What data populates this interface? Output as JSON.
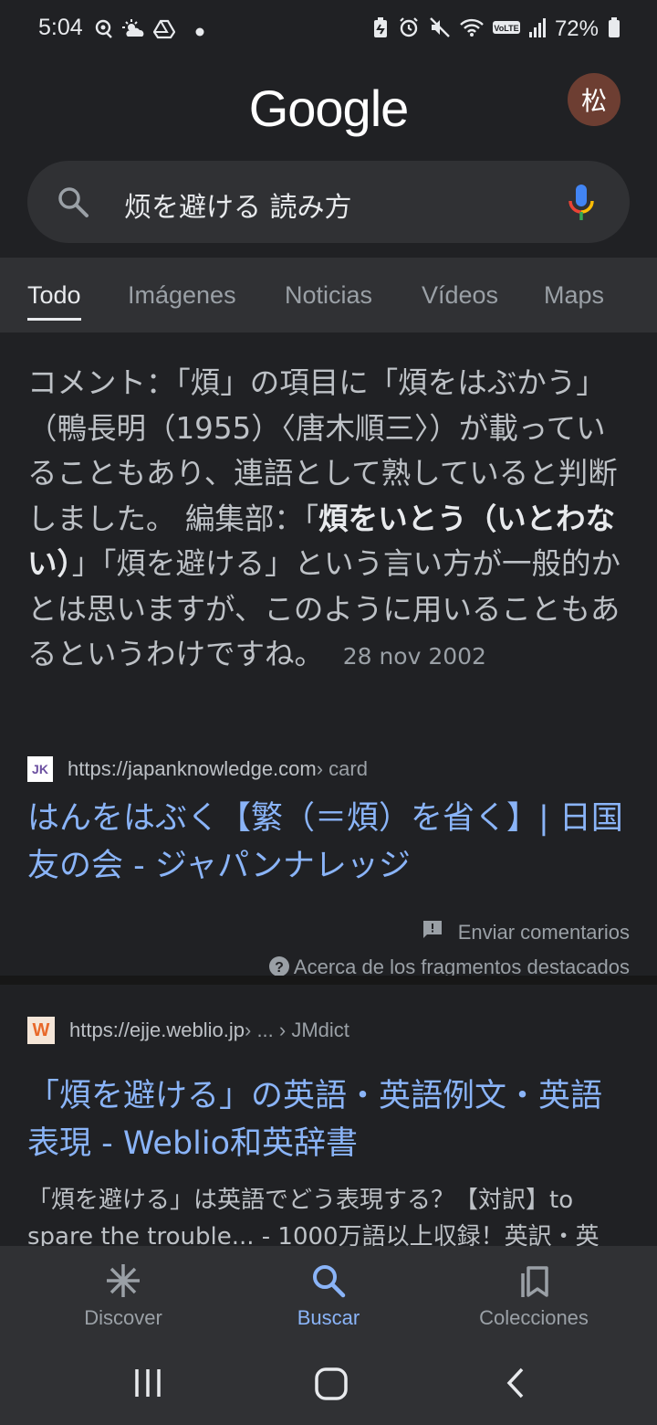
{
  "status_bar": {
    "time": "5:04",
    "battery": "72%",
    "left_icons": [
      "vpn-key-icon",
      "weather-icon",
      "drive-icon",
      "dot-icon"
    ],
    "right_icons": [
      "battery-saver-icon",
      "alarm-icon",
      "mute-icon",
      "wifi-icon",
      "volte-icon",
      "signal-icon",
      "battery-icon"
    ]
  },
  "header": {
    "logo": "Google",
    "avatar_letter": "松",
    "avatar_color": "#6d3e32"
  },
  "search": {
    "query": "烦を避ける 読み方"
  },
  "tabs": [
    {
      "label": "Todo",
      "active": true
    },
    {
      "label": "Imágenes",
      "active": false
    },
    {
      "label": "Noticias",
      "active": false
    },
    {
      "label": "Vídeos",
      "active": false
    },
    {
      "label": "Maps",
      "active": false
    }
  ],
  "featured_snippet": {
    "text_before": "コメント：「煩」の項目に「煩をはぶかう」（鴨長明（1955）〈唐木順三〉）が載っていることもあり、連語として熟していると判断しました。 編集部：「",
    "bold": "煩をいとう（いとわない）",
    "text_after": "」「煩を避ける」という言い方が一般的かとは思いますが、このように用いることもあるというわけですね。",
    "date": "28 nov 2002",
    "source": {
      "favicon": "JK",
      "url": "https://japanknowledge.com",
      "crumb": " › card"
    },
    "title": "はんをはぶく【繁（＝煩）を省く】| 日国友の会 - ジャパンナレッジ",
    "feedback": "Enviar comentarios",
    "about": "Acerca de los fragmentos destacados"
  },
  "result2": {
    "favicon": "W",
    "url": "https://ejje.weblio.jp",
    "crumb": " › ... › JMdict",
    "title": "「煩を避ける」の英語・英語例文・英語表現 - Weblio和英辞書",
    "description": "「煩を避ける」は英語でどう表現する？【対訳】to spare the trouble... - 1000万語以上収録！英訳・英"
  },
  "bottom_nav": [
    {
      "label": "Discover",
      "icon": "asterisk-icon",
      "active": false
    },
    {
      "label": "Buscar",
      "icon": "search-icon",
      "active": true
    },
    {
      "label": "Colecciones",
      "icon": "collections-icon",
      "active": false
    }
  ],
  "system_nav": [
    "recents-icon",
    "home-icon",
    "back-icon"
  ],
  "colors": {
    "background": "#202124",
    "surface": "#303134",
    "link": "#8ab4f8",
    "text": "#bdc1c6"
  }
}
